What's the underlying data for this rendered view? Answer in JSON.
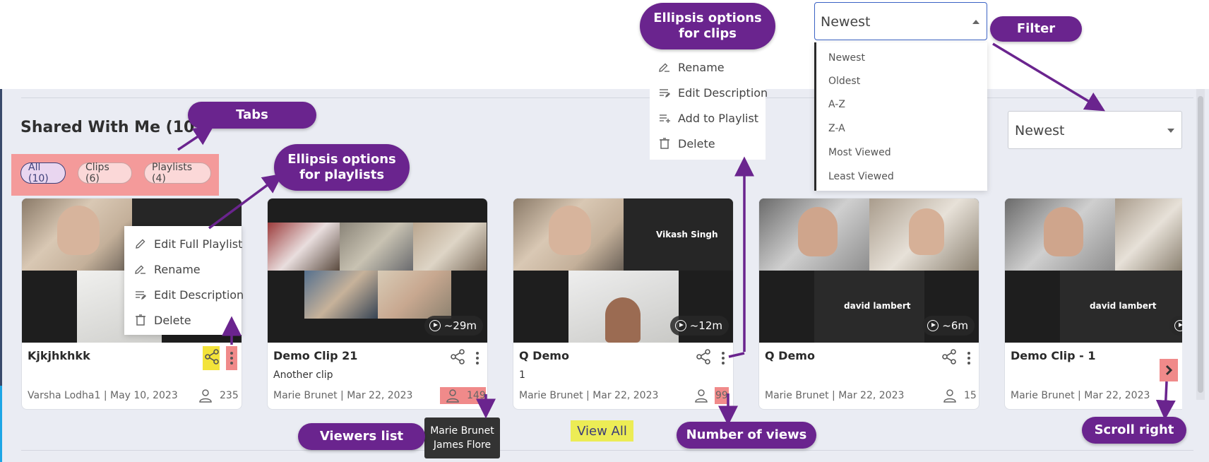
{
  "section": {
    "title": "Shared With Me (10)"
  },
  "tabs": [
    {
      "label": "All (10)",
      "active": true
    },
    {
      "label": "Clips (6)",
      "active": false
    },
    {
      "label": "Playlists (4)",
      "active": false
    }
  ],
  "filter": {
    "selected": "Newest",
    "open_value": "Newest",
    "options": [
      "Newest",
      "Oldest",
      "A-Z",
      "Z-A",
      "Most Viewed",
      "Least Viewed"
    ]
  },
  "clip_menu": {
    "items": [
      "Rename",
      "Edit Description",
      "Add to Playlist",
      "Delete"
    ]
  },
  "playlist_menu": {
    "items": [
      "Edit Full Playlist",
      "Rename",
      "Edit Description",
      "Delete"
    ]
  },
  "cards": [
    {
      "title": "Kjkjhkhkk",
      "subtitle": "",
      "author_date": "Varsha Lodha1 | May 10, 2023",
      "views": "235",
      "duration": "",
      "tile_names": []
    },
    {
      "title": "Demo Clip 21",
      "subtitle": "Another clip",
      "author_date": "Marie Brunet | Mar 22, 2023",
      "views": "149",
      "duration": "~29m",
      "tile_names": []
    },
    {
      "title": "Q Demo",
      "subtitle": "1",
      "author_date": "Marie Brunet | Mar 22, 2023",
      "views": "99",
      "duration": "~12m",
      "tile_names": [
        "Vikash Singh"
      ]
    },
    {
      "title": "Q Demo",
      "subtitle": "",
      "author_date": "Marie Brunet | Mar 22, 2023",
      "views": "15",
      "duration": "~6m",
      "tile_names": [
        "david lambert"
      ]
    },
    {
      "title": "Demo Clip - 1",
      "subtitle": "",
      "author_date": "Marie Brunet | Mar 22, 2023",
      "views": "",
      "duration": "",
      "tile_names": [
        "david lambert"
      ]
    }
  ],
  "view_all": "View All",
  "tooltip": {
    "lines": [
      "Marie Brunet",
      "James Flore"
    ]
  },
  "annotations": {
    "tabs": "Tabs",
    "filter": "Filter",
    "clip_ellipsis": "Ellipsis options for clips",
    "playlist_ellipsis": "Ellipsis options for playlists",
    "viewers_list": "Viewers list",
    "number_of_views": "Number of views",
    "scroll_right": "Scroll right"
  },
  "colors": {
    "annotation": "#6a248e",
    "highlight_red": "#f08a8a",
    "highlight_yellow": "#f3e33a",
    "accent": "#3c3f78"
  },
  "icons": [
    "share-icon",
    "ellipsis-icon",
    "person-icon",
    "play-icon",
    "pencil-icon",
    "rename-icon",
    "edit-description-icon",
    "add-to-playlist-icon",
    "trash-icon",
    "chevron-right-icon",
    "caret-up-icon",
    "caret-down-icon"
  ]
}
